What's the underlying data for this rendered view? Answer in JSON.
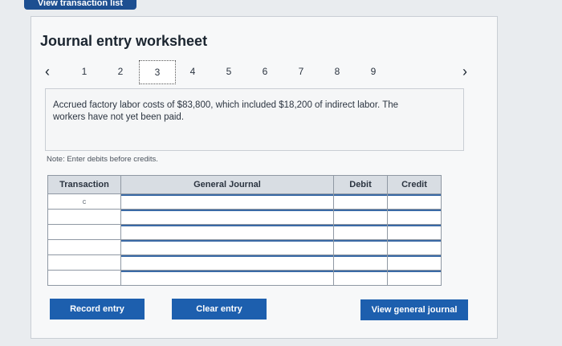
{
  "header": {
    "tab_label": "View transaction list"
  },
  "worksheet": {
    "title": "Journal entry worksheet",
    "pages": [
      "1",
      "2",
      "3",
      "4",
      "5",
      "6",
      "7",
      "8",
      "9"
    ],
    "active_page": "3",
    "description": "Accrued factory labor costs of $83,800, which included $18,200 of indirect labor. The workers have not yet been paid.",
    "note": "Note: Enter debits before credits."
  },
  "table": {
    "headers": {
      "transaction": "Transaction",
      "general_journal": "General Journal",
      "debit": "Debit",
      "credit": "Credit"
    },
    "transaction_value": "c"
  },
  "buttons": {
    "record": "Record entry",
    "clear": "Clear entry",
    "view": "View general journal"
  }
}
